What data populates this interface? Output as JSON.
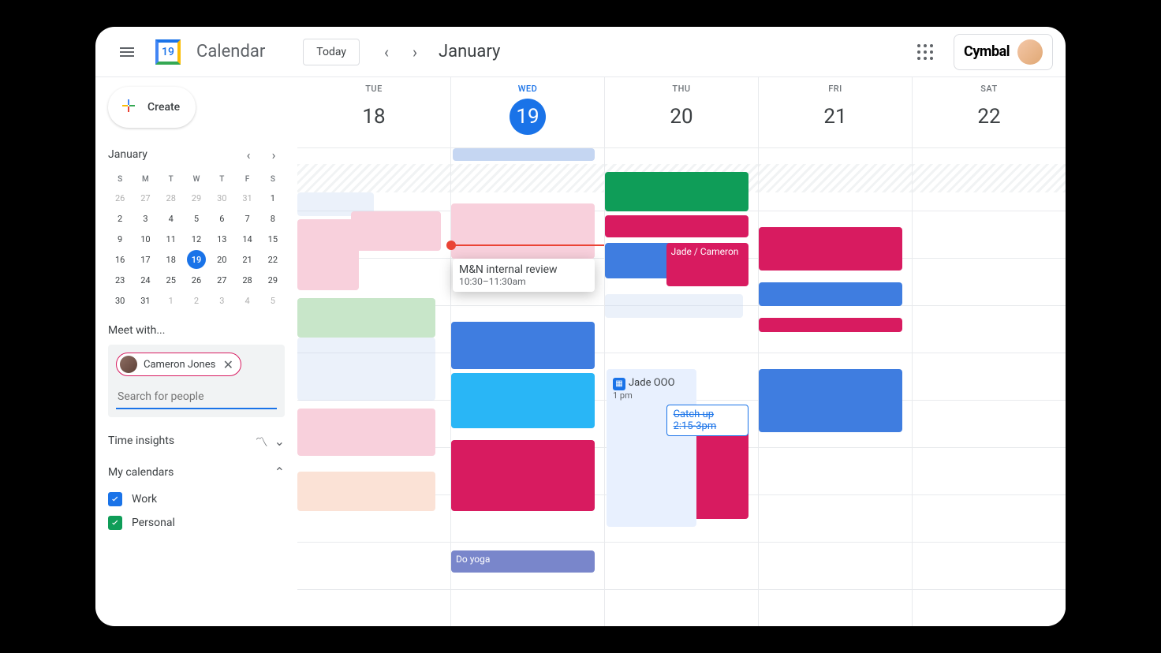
{
  "header": {
    "app_name": "Calendar",
    "logo_day": "19",
    "today_label": "Today",
    "month_label": "January",
    "brand": "Cymbal"
  },
  "sidebar": {
    "create_label": "Create",
    "mini_month": "January",
    "dow": [
      "S",
      "M",
      "T",
      "W",
      "T",
      "F",
      "S"
    ],
    "weeks": [
      [
        {
          "d": "26",
          "dim": true
        },
        {
          "d": "27",
          "dim": true
        },
        {
          "d": "28",
          "dim": true
        },
        {
          "d": "29",
          "dim": true
        },
        {
          "d": "30",
          "dim": true
        },
        {
          "d": "31",
          "dim": true
        },
        {
          "d": "1"
        }
      ],
      [
        {
          "d": "2"
        },
        {
          "d": "3"
        },
        {
          "d": "4"
        },
        {
          "d": "5"
        },
        {
          "d": "6"
        },
        {
          "d": "7"
        },
        {
          "d": "8"
        }
      ],
      [
        {
          "d": "9"
        },
        {
          "d": "10"
        },
        {
          "d": "11"
        },
        {
          "d": "12"
        },
        {
          "d": "13"
        },
        {
          "d": "14"
        },
        {
          "d": "15"
        }
      ],
      [
        {
          "d": "16"
        },
        {
          "d": "17"
        },
        {
          "d": "18"
        },
        {
          "d": "19",
          "today": true
        },
        {
          "d": "20"
        },
        {
          "d": "21"
        },
        {
          "d": "22"
        }
      ],
      [
        {
          "d": "23"
        },
        {
          "d": "24"
        },
        {
          "d": "25"
        },
        {
          "d": "26"
        },
        {
          "d": "27"
        },
        {
          "d": "28"
        },
        {
          "d": "29"
        }
      ],
      [
        {
          "d": "30"
        },
        {
          "d": "31"
        },
        {
          "d": "1",
          "dim": true
        },
        {
          "d": "2",
          "dim": true
        },
        {
          "d": "3",
          "dim": true
        },
        {
          "d": "4",
          "dim": true
        },
        {
          "d": "5",
          "dim": true
        }
      ]
    ],
    "meet_with_label": "Meet with...",
    "chip_name": "Cameron Jones",
    "search_placeholder": "Search for people",
    "time_insights_label": "Time insights",
    "my_calendars_label": "My calendars",
    "calendars": [
      {
        "label": "Work",
        "color": "blue"
      },
      {
        "label": "Personal",
        "color": "green"
      }
    ]
  },
  "days": [
    {
      "dow": "TUE",
      "num": "18",
      "today": false
    },
    {
      "dow": "WED",
      "num": "19",
      "today": true
    },
    {
      "dow": "THU",
      "num": "20",
      "today": false
    },
    {
      "dow": "FRI",
      "num": "21",
      "today": false
    },
    {
      "dow": "SAT",
      "num": "22",
      "today": false
    }
  ],
  "new_event": {
    "title": "M&N internal review",
    "time": "10:30–11:30am"
  },
  "jade_event": {
    "title": "Jade / Cameron"
  },
  "ooo_event": {
    "title": "Jade OOO",
    "time": "1 pm"
  },
  "catchup_event": {
    "title": "Catch up",
    "time": "2:15-3pm"
  },
  "yoga_event": {
    "title": "Do yoga"
  },
  "colors": {
    "pink_light": "#f8d0dc",
    "pink": "#e91e63",
    "blue": "#3f7de0",
    "skyblue": "#29b6f6",
    "green": "#0f9d58",
    "green_light": "#c8e6c9",
    "grayblue": "#c5d6f2",
    "crimson": "#d81b60",
    "purple": "#7986cb",
    "peach": "#fbe2d6",
    "lightblue": "#d2e3fc"
  }
}
